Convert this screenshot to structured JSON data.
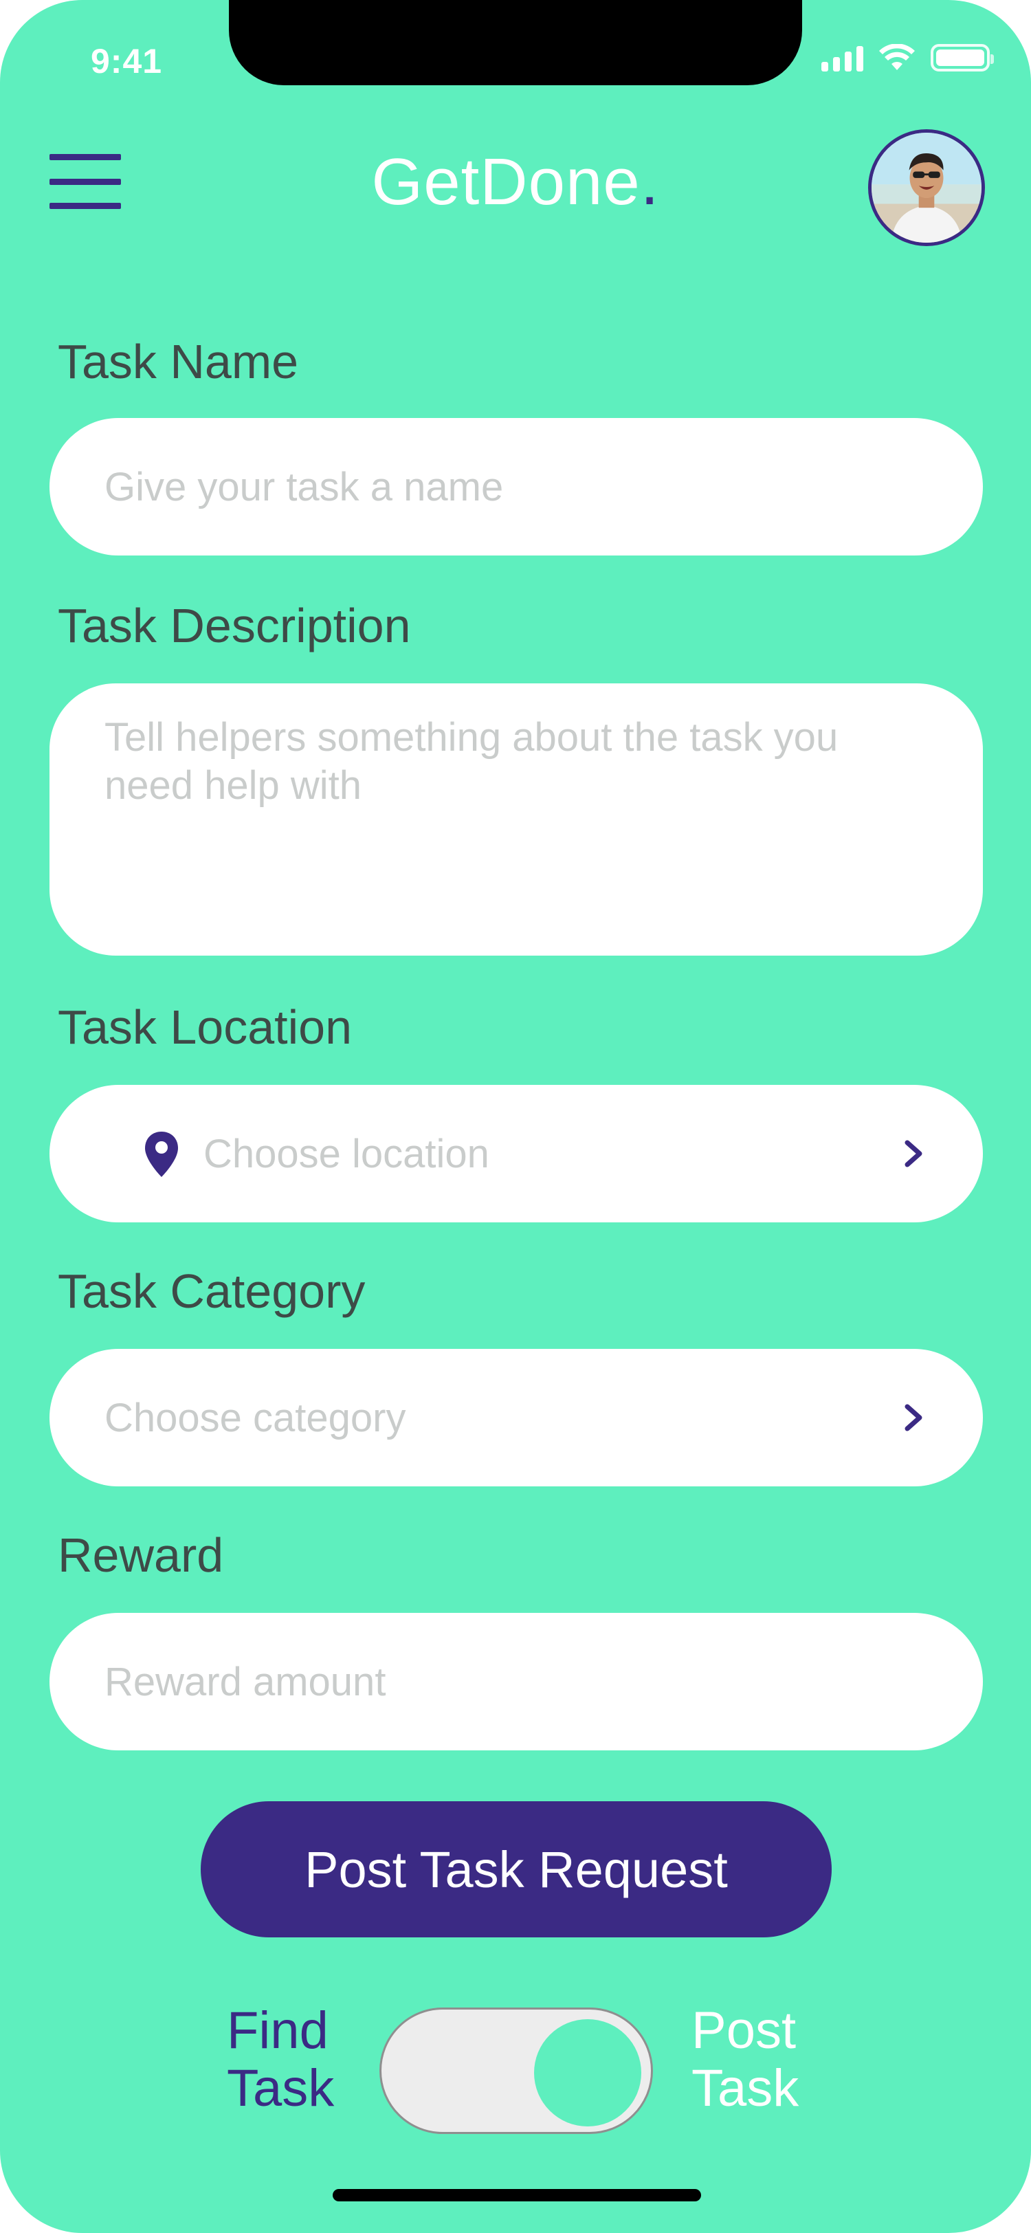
{
  "status_bar": {
    "time": "9:41"
  },
  "header": {
    "app_name": "GetDone",
    "app_name_dot": ".",
    "menu_icon": "hamburger-menu-icon",
    "avatar_icon": "user-avatar"
  },
  "form": {
    "task_name": {
      "label": "Task Name",
      "placeholder": "Give your task a name",
      "value": ""
    },
    "task_description": {
      "label": "Task Description",
      "placeholder": "Tell helpers something about the task you need help with",
      "value": ""
    },
    "task_location": {
      "label": "Task Location",
      "placeholder": "Choose location",
      "icon": "location-pin-icon"
    },
    "task_category": {
      "label": "Task Category",
      "placeholder": "Choose category",
      "icon": "chevron-right-icon"
    },
    "reward": {
      "label": "Reward",
      "placeholder": "Reward amount",
      "value": ""
    }
  },
  "submit": {
    "label": "Post Task Request"
  },
  "mode_toggle": {
    "left_label_line1": "Find",
    "left_label_line2": "Task",
    "right_label_line1": "Post",
    "right_label_line2": "Task",
    "selected": "Post Task"
  },
  "colors": {
    "background": "#5EEFBE",
    "accent": "#3B2A84",
    "label_text": "#3E4A47",
    "field_bg": "#FFFFFF",
    "placeholder": "#C9CCCB"
  }
}
